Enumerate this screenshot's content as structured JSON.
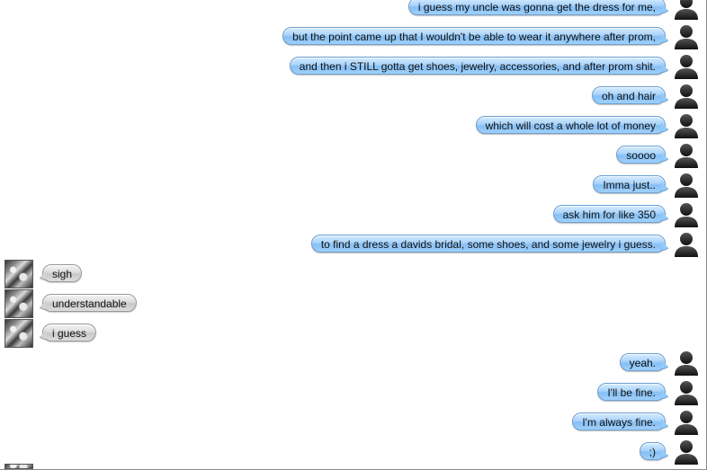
{
  "messages": [
    {
      "sender": "me",
      "text": "i guess my uncle was gonna get the dress for me,"
    },
    {
      "sender": "me",
      "text": "but the point came up that I wouldn't be able to wear it anywhere after prom,"
    },
    {
      "sender": "me",
      "text": "and then i STILL gotta get shoes, jewelry, accessories, and after prom shit."
    },
    {
      "sender": "me",
      "text": "oh and hair"
    },
    {
      "sender": "me",
      "text": "which will cost a whole lot of money"
    },
    {
      "sender": "me",
      "text": "soooo"
    },
    {
      "sender": "me",
      "text": "Imma just.."
    },
    {
      "sender": "me",
      "text": "ask him for like 350"
    },
    {
      "sender": "me",
      "text": "to find a dress a davids bridal, some shoes, and some jewelry i guess."
    },
    {
      "sender": "them",
      "text": "sigh"
    },
    {
      "sender": "them",
      "text": "understandable"
    },
    {
      "sender": "them",
      "text": "i guess"
    },
    {
      "sender": "me",
      "text": "yeah."
    },
    {
      "sender": "me",
      "text": "I'll be fine."
    },
    {
      "sender": "me",
      "text": "I'm always fine."
    },
    {
      "sender": "me",
      "text": ";)"
    }
  ]
}
